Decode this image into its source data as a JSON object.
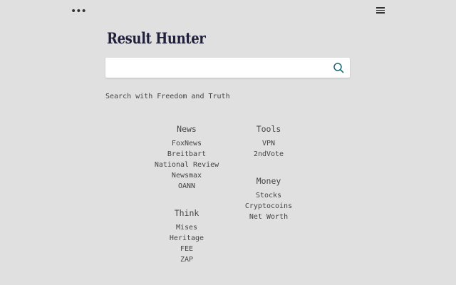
{
  "header": {
    "menu_dots": "•••",
    "logo": "Result Hunter"
  },
  "search": {
    "value": "",
    "placeholder": ""
  },
  "tagline": "Search with Freedom and Truth",
  "sections": {
    "news": {
      "title": "News",
      "links": [
        "FoxNews",
        "Breitbart",
        "National Review",
        "Newsmax",
        "OANN"
      ]
    },
    "think": {
      "title": "Think",
      "links": [
        "Mises",
        "Heritage",
        "FEE",
        "ZAP"
      ]
    },
    "tools": {
      "title": "Tools",
      "links": [
        "VPN",
        "2ndVote"
      ]
    },
    "money": {
      "title": "Money",
      "links": [
        "Stocks",
        "Cryptocoins",
        "Net Worth"
      ]
    }
  },
  "colors": {
    "background": "#e0e0e0",
    "search_icon": "#1a6b75"
  }
}
